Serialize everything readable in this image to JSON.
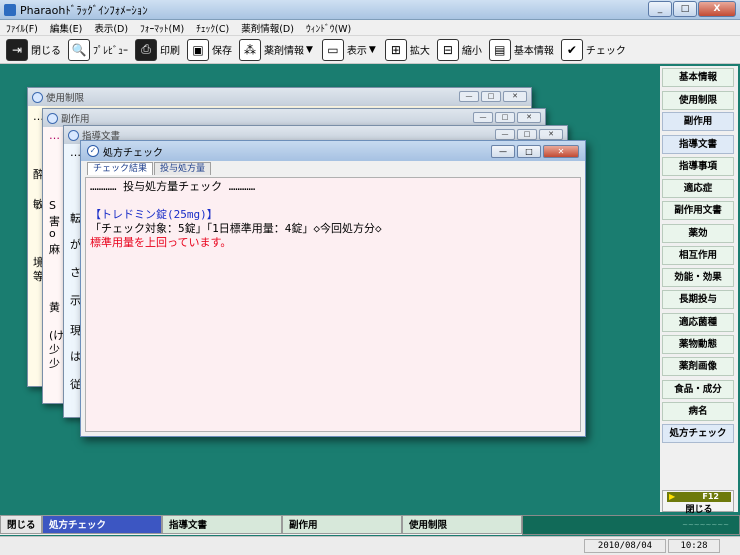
{
  "app": {
    "title": "Pharaohﾄﾞﾗｯｸﾞｲﾝﾌｫﾒｰｼｮﾝ"
  },
  "caption": {
    "min": "_",
    "max": "□",
    "close": "X"
  },
  "menu": [
    "ﾌｧｲﾙ(F)",
    "編集(E)",
    "表示(D)",
    "ﾌｫｰﾏｯﾄ(M)",
    "ﾁｪｯｸ(C)",
    "薬剤情報(D)",
    "ｳｨﾝﾄﾞｳ(W)"
  ],
  "toolbar": {
    "close": "閉じる",
    "preview": "ﾌﾟﾚﾋﾞｭｰ",
    "print": "印刷",
    "save": "保存",
    "druginfo": "薬剤情報",
    "view": "表示",
    "zoomin": "拡大",
    "zoomout": "縮小",
    "basic": "基本情報",
    "check": "チェック"
  },
  "rightnav": [
    "基本情報",
    "使用制限",
    "副作用",
    "指導文書",
    "指導事項",
    "適応症",
    "副作用文書",
    "薬効",
    "相互作用",
    "効能・効果",
    "長期投与",
    "適応菌種",
    "薬物動態",
    "薬剤画像",
    "食品・成分",
    "病名",
    "処方チェック"
  ],
  "rightnav_close": {
    "key": "F12",
    "label": "閉じる"
  },
  "windows": {
    "w1": {
      "title": "使用制限"
    },
    "w2": {
      "title": "副作用"
    },
    "w3": {
      "title": "指導文書"
    },
    "active": {
      "title": "処方チェック"
    }
  },
  "peeks": {
    "w1": [
      "…",
      "酔",
      "敏",
      "境",
      "等"
    ],
    "w2": [
      "…",
      "S",
      "害",
      "o",
      "麻",
      "黄",
      "(け",
      "少",
      "少"
    ],
    "w3": [
      "…",
      "転",
      "が",
      "さ",
      "示",
      "現",
      "は",
      "従"
    ]
  },
  "active": {
    "tabs": [
      "チェック結果",
      "投与処方量"
    ],
    "heading": "…………      投与処方量チェック      …………",
    "drug": "【トレドミン錠(25mg)】",
    "detail": "「チェック対象：5錠」「1日標準用量：4錠」◇今回処方分◇",
    "warning": "標準用量を上回っています。"
  },
  "taskbar": [
    "閉じる",
    "処方チェック",
    "指導文書",
    "副作用",
    "使用制限"
  ],
  "status": {
    "date": "2010/08/04",
    "time": "10:28"
  }
}
